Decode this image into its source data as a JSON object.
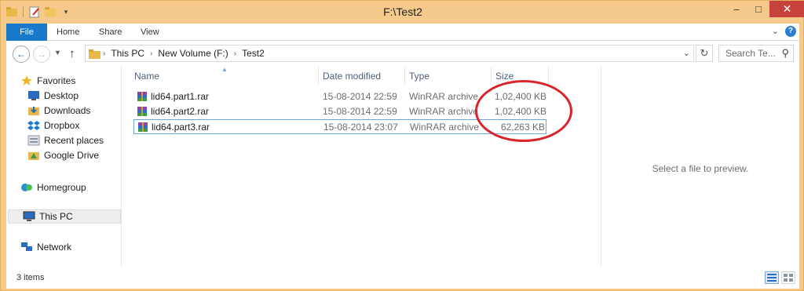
{
  "window": {
    "title": "F:\\Test2"
  },
  "titlebar_buttons": {
    "minimize": "–",
    "maximize": "□",
    "close": "✕"
  },
  "ribbon": {
    "tabs": [
      "File",
      "Home",
      "Share",
      "View"
    ],
    "expand_icon": "chevron-down-icon",
    "help_icon": "help-icon",
    "help_label": "?"
  },
  "navigation": {
    "breadcrumb": [
      "This PC",
      "New Volume (F:)",
      "Test2"
    ],
    "search_placeholder": "Search Te..."
  },
  "nav_pane": {
    "favorites": {
      "label": "Favorites",
      "items": [
        "Desktop",
        "Downloads",
        "Dropbox",
        "Recent places",
        "Google Drive"
      ]
    },
    "homegroup": "Homegroup",
    "this_pc": "This PC",
    "network": "Network"
  },
  "file_list": {
    "columns": [
      "Name",
      "Date modified",
      "Type",
      "Size"
    ],
    "rows": [
      {
        "name": "lid64.part1.rar",
        "date": "15-08-2014 22:59",
        "type": "WinRAR archive",
        "size": "1,02,400 KB"
      },
      {
        "name": "lid64.part2.rar",
        "date": "15-08-2014 22:59",
        "type": "WinRAR archive",
        "size": "1,02,400 KB"
      },
      {
        "name": "lid64.part3.rar",
        "date": "15-08-2014 23:07",
        "type": "WinRAR archive",
        "size": "62,263 KB"
      }
    ]
  },
  "preview": {
    "message": "Select a file to preview."
  },
  "status": {
    "item_count": "3 items"
  },
  "colors": {
    "accent": "#1979ca",
    "window_frame": "#f5c98a",
    "annotation": "#d9242a",
    "close_button": "#c7423b"
  }
}
